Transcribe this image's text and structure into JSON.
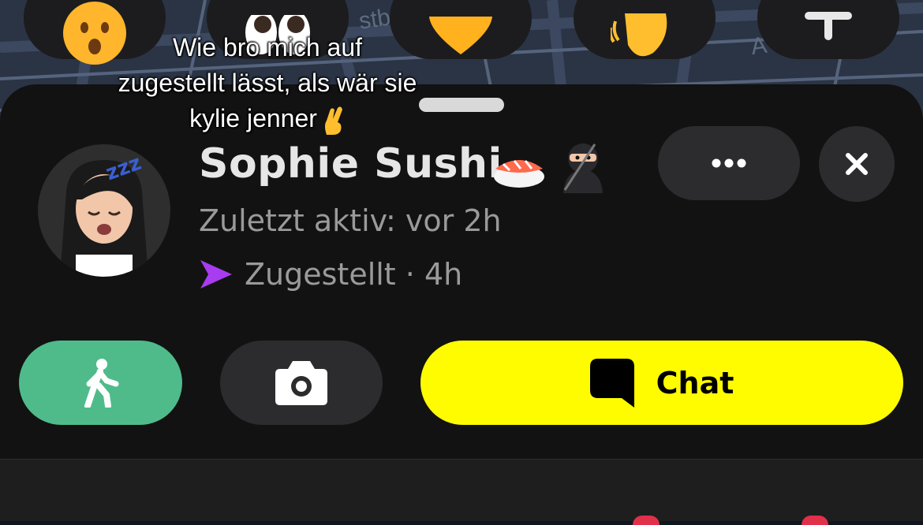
{
  "map": {
    "street_label_1": "stb",
    "street_label_2": "A"
  },
  "reactions": [
    {
      "name": "surprised-face-icon"
    },
    {
      "name": "eyes-icon"
    },
    {
      "name": "heart-icon"
    },
    {
      "name": "waving-hand-icon"
    },
    {
      "name": "plus-icon"
    }
  ],
  "caption": {
    "line1": "Wie bro mich auf",
    "line2": "zugestellt lässt, als wär sie",
    "line3": "kylie jenner",
    "emoji_icon": "crossed-fingers-icon"
  },
  "profile": {
    "name": "Sophie Sushi",
    "name_emojis": [
      "sushi-icon",
      "ninja-icon"
    ],
    "last_active": "Zuletzt aktiv: vor 2h",
    "status": "Zugestellt · 4h",
    "status_icon": "sent-arrow-icon",
    "status_color": "#a83cf0"
  },
  "actions": {
    "more_icon": "more-dots-icon",
    "close_icon": "close-icon",
    "walk_icon": "walking-person-icon",
    "camera_icon": "camera-icon",
    "chat_label": "Chat",
    "chat_icon": "chat-bubble-icon"
  },
  "colors": {
    "chat_yellow": "#fffc00",
    "walk_green": "#4fbb8a",
    "sheet_bg": "#121212",
    "button_gray": "#2c2c2e"
  }
}
